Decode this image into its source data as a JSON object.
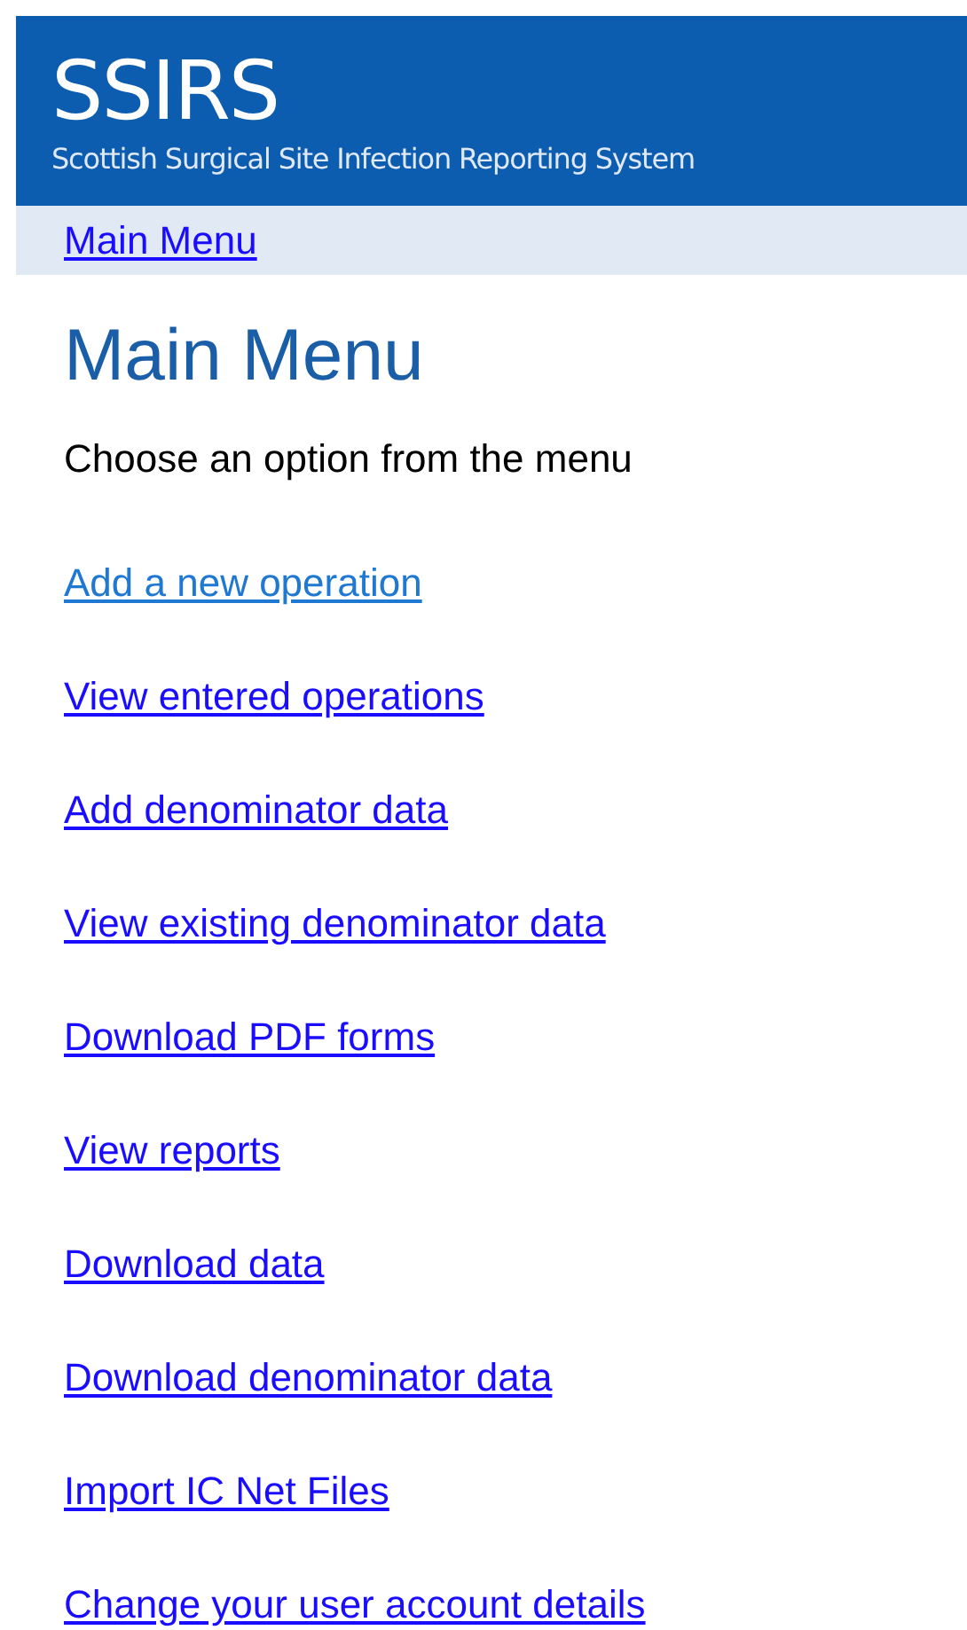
{
  "header": {
    "logo": "SSIRS",
    "subtitle": "Scottish Surgical Site Infection Reporting System"
  },
  "breadcrumb": "Main Menu",
  "title": "Main Menu",
  "intro": "Choose an option from the menu",
  "menu_links": [
    {
      "label": "Add a new operation",
      "hovered": true
    },
    {
      "label": "View entered operations",
      "hovered": false
    },
    {
      "label": "Add denominator data",
      "hovered": false
    },
    {
      "label": "View existing denominator data",
      "hovered": false
    },
    {
      "label": "Download PDF forms",
      "hovered": false
    },
    {
      "label": "View reports",
      "hovered": false
    },
    {
      "label": "Download data",
      "hovered": false
    },
    {
      "label": "Download denominator data",
      "hovered": false
    },
    {
      "label": "Import IC Net Files",
      "hovered": false
    },
    {
      "label": "Change your user account details",
      "hovered": false
    }
  ]
}
